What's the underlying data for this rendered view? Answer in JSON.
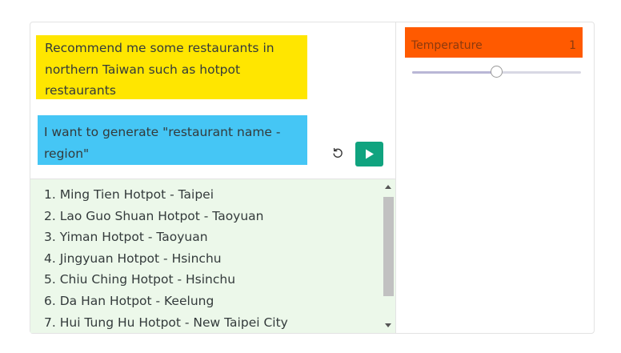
{
  "prompt": {
    "lines": [
      "Recommend me some restaurants in",
      "northern Taiwan such as hotpot",
      "restaurants"
    ]
  },
  "instruction": {
    "lines": [
      "I want to generate \"restaurant name -",
      "region\""
    ]
  },
  "actions": {
    "reset_icon": "rotate-ccw-icon",
    "run_icon": "play-icon"
  },
  "output": {
    "items": [
      "1. Ming Tien Hotpot - Taipei",
      "2. Lao Guo Shuan Hotpot - Taoyuan",
      "3. Yiman Hotpot - Taoyuan",
      "4. Jingyuan Hotpot - Hsinchu",
      "5. Chiu Ching Hotpot - Hsinchu",
      "6. Da Han Hotpot - Keelung",
      "7. Hui Tung Hu Hotpot - New Taipei City"
    ]
  },
  "settings": {
    "temperature": {
      "label": "Temperature",
      "value": "1",
      "slider_fraction": 0.5
    }
  },
  "colors": {
    "prompt_bg": "#ffe600",
    "instruction_bg": "#45c6f5",
    "output_bg": "#ecf8ea",
    "run_button": "#10a37f",
    "temperature_header": "#ff5a00"
  }
}
